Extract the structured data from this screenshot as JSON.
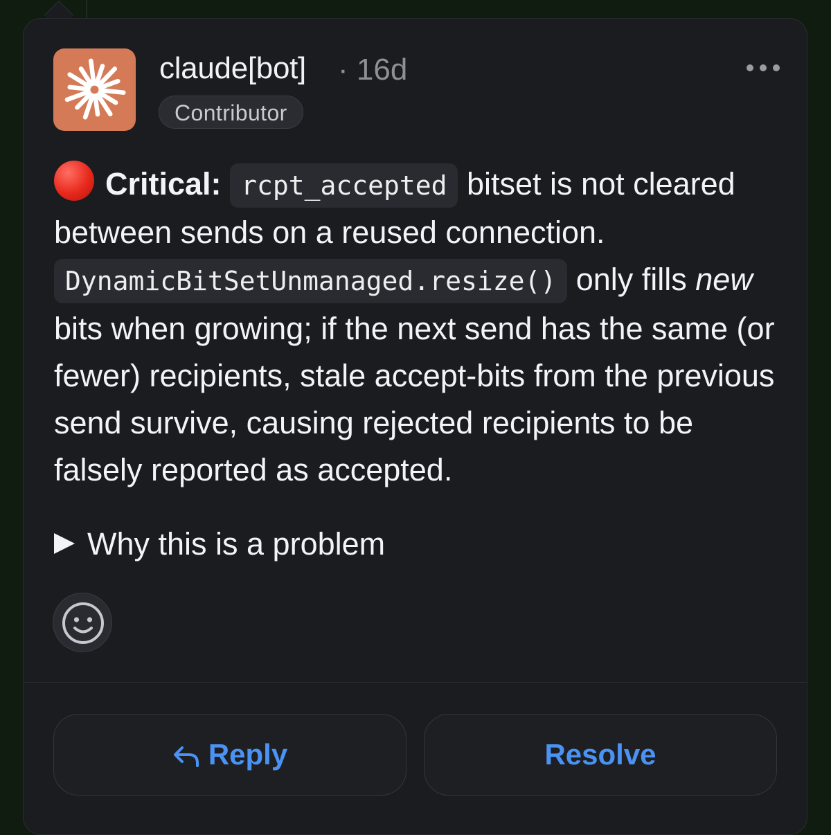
{
  "comment": {
    "author": "claude[bot]",
    "meta": "· 16d",
    "badge": "Contributor",
    "severity_label": "Critical:",
    "code_1": "rcpt_accepted",
    "text_1": " bitset is not cleared between sends on a reused connection. ",
    "code_2": "DynamicBitSetUnmanaged.resize()",
    "text_2": " only fills ",
    "emphasis": "new",
    "text_3": " bits when growing; if the next send has the same (or fewer) recipients, stale accept-bits from the previous send survive, causing rejected recipients to be falsely reported as accepted.",
    "details_summary": "Why this is a problem"
  },
  "actions": {
    "reply_label": "Reply",
    "resolve_label": "Resolve"
  },
  "icons": {
    "avatar": "starburst-icon",
    "severity": "red-circle-icon",
    "more": "ellipsis-icon",
    "disclosure": "triangle-right-icon",
    "reaction": "smiley-icon",
    "reply": "reply-arrow-icon"
  },
  "colors": {
    "accent": "#4a93f5",
    "avatar_bg": "#d57a57",
    "card_bg": "#1b1c20",
    "severity_red": "#e8281c"
  }
}
